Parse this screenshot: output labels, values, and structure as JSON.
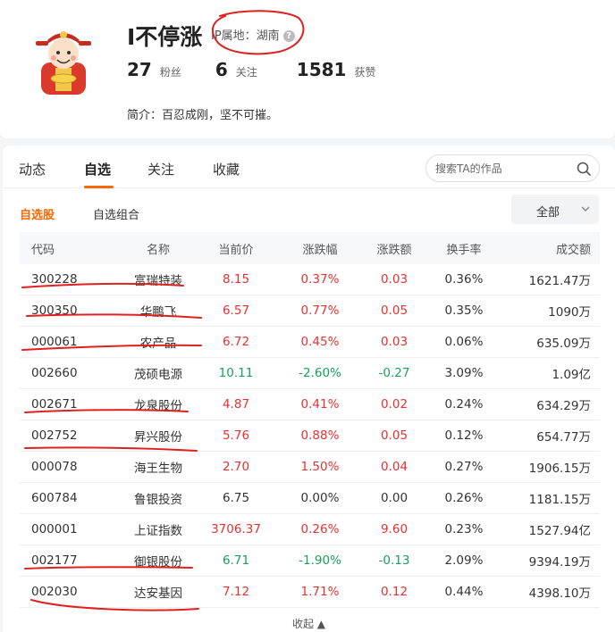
{
  "profile": {
    "username": "I不停涨",
    "ip_location": "IP属地：湖南",
    "stats": [
      {
        "value": "27",
        "label": "粉丝"
      },
      {
        "value": "6",
        "label": "关注"
      },
      {
        "value": "1581",
        "label": "获赞"
      }
    ],
    "intro": "简介：百忍成刚，坚不可摧。"
  },
  "tabs": [
    "动态",
    "自选",
    "关注",
    "收藏"
  ],
  "active_tab": "自选",
  "search": {
    "placeholder": "搜索TA的作品"
  },
  "subtabs": [
    "自选股",
    "自选组合"
  ],
  "filter": {
    "label": "全部"
  },
  "table": {
    "headers": [
      "代码",
      "名称",
      "当前价",
      "涨跌幅",
      "涨跌额",
      "换手率",
      "成交额"
    ],
    "rows": [
      {
        "code": "300228",
        "name": "富瑞特装",
        "price": "8.15",
        "pct": "0.37%",
        "chg": "0.03",
        "turnover": "0.36%",
        "volume": "1621.47万",
        "dir": "up"
      },
      {
        "code": "300350",
        "name": "华鹏飞",
        "price": "6.57",
        "pct": "0.77%",
        "chg": "0.05",
        "turnover": "0.35%",
        "volume": "1090万",
        "dir": "up"
      },
      {
        "code": "000061",
        "name": "农产品",
        "price": "6.72",
        "pct": "0.45%",
        "chg": "0.03",
        "turnover": "0.06%",
        "volume": "635.09万",
        "dir": "up"
      },
      {
        "code": "002660",
        "name": "茂硕电源",
        "price": "10.11",
        "pct": "-2.60%",
        "chg": "-0.27",
        "turnover": "3.09%",
        "volume": "1.09亿",
        "dir": "down"
      },
      {
        "code": "002671",
        "name": "龙泉股份",
        "price": "4.87",
        "pct": "0.41%",
        "chg": "0.02",
        "turnover": "0.24%",
        "volume": "634.29万",
        "dir": "up"
      },
      {
        "code": "002752",
        "name": "昇兴股份",
        "price": "5.76",
        "pct": "0.88%",
        "chg": "0.05",
        "turnover": "0.12%",
        "volume": "654.77万",
        "dir": "up"
      },
      {
        "code": "000078",
        "name": "海王生物",
        "price": "2.70",
        "pct": "1.50%",
        "chg": "0.04",
        "turnover": "0.27%",
        "volume": "1906.15万",
        "dir": "up"
      },
      {
        "code": "600784",
        "name": "鲁银投资",
        "price": "6.75",
        "pct": "0.00%",
        "chg": "0.00",
        "turnover": "0.26%",
        "volume": "1181.15万",
        "dir": "flat"
      },
      {
        "code": "000001",
        "name": "上证指数",
        "price": "3706.37",
        "pct": "0.26%",
        "chg": "9.60",
        "turnover": "0.23%",
        "volume": "1527.94亿",
        "dir": "up"
      },
      {
        "code": "002177",
        "name": "御银股份",
        "price": "6.71",
        "pct": "-1.90%",
        "chg": "-0.13",
        "turnover": "2.09%",
        "volume": "9394.19万",
        "dir": "down"
      },
      {
        "code": "002030",
        "name": "达安基因",
        "price": "7.12",
        "pct": "1.71%",
        "chg": "0.12",
        "turnover": "0.44%",
        "volume": "4398.10万",
        "dir": "up"
      }
    ]
  },
  "collapse_label": "收起 ▲",
  "colors": {
    "accent": "#ff6600",
    "up": "#e93030",
    "down": "#19a05a",
    "annotation": "#e02020"
  },
  "icons": {
    "avatar": "cartoon-god-of-wealth-avatar",
    "help": "question-circle-icon",
    "search": "search-icon",
    "chevron": "chevron-down-icon"
  }
}
